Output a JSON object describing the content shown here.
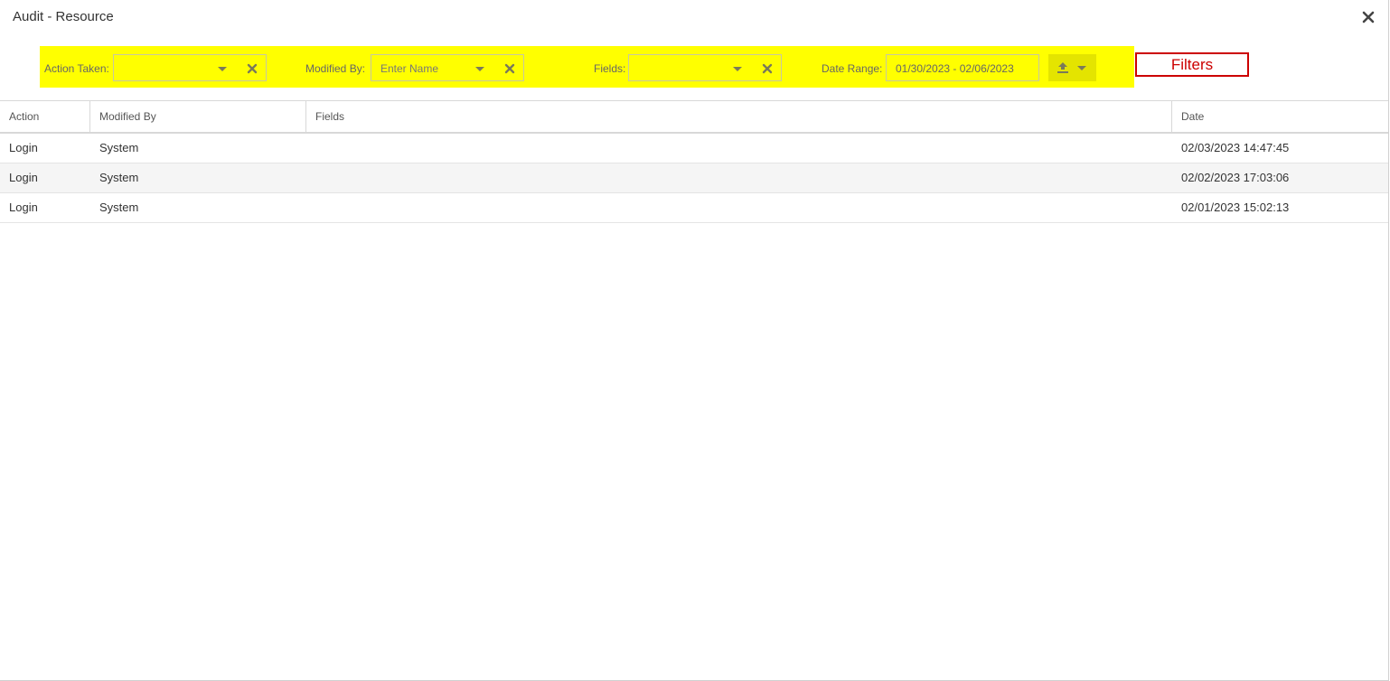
{
  "window": {
    "title": "Audit - Resource",
    "close_icon": "close-icon"
  },
  "filters": {
    "action_taken": {
      "label": "Action Taken:",
      "value": ""
    },
    "modified_by": {
      "label": "Modified By:",
      "placeholder": "Enter Name"
    },
    "fields": {
      "label": "Fields:",
      "value": ""
    },
    "date_range": {
      "label": "Date Range:",
      "value": "01/30/2023 - 02/06/2023"
    },
    "export_icon": "upload-icon",
    "highlight_color": "#ffff00"
  },
  "annotation": {
    "label": "Filters",
    "color": "#cc0000"
  },
  "table": {
    "columns": [
      "Action",
      "Modified By",
      "Fields",
      "Date"
    ],
    "rows": [
      {
        "action": "Login",
        "modified_by": "System",
        "fields": "",
        "date": "02/03/2023 14:47:45"
      },
      {
        "action": "Login",
        "modified_by": "System",
        "fields": "",
        "date": "02/02/2023 17:03:06"
      },
      {
        "action": "Login",
        "modified_by": "System",
        "fields": "",
        "date": "02/01/2023 15:02:13"
      }
    ]
  }
}
